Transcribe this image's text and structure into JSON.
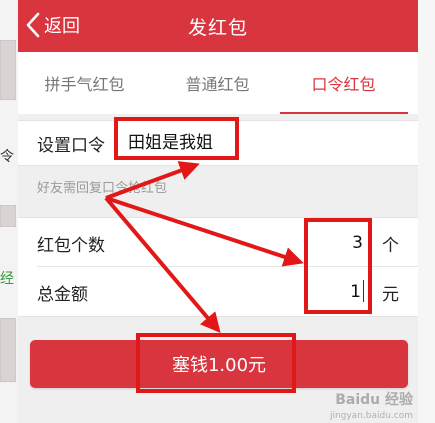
{
  "header": {
    "back_label": "返回",
    "title": "发红包"
  },
  "tabs": [
    {
      "label": "拼手气红包"
    },
    {
      "label": "普通红包"
    },
    {
      "label": "口令红包"
    }
  ],
  "command": {
    "label": "设置口令",
    "value": "田姐是我姐"
  },
  "hint": "好友需回复口令抢红包",
  "count": {
    "label": "红包个数",
    "value": "3",
    "unit": "个"
  },
  "amount": {
    "label": "总金额",
    "value": "1",
    "unit": "元"
  },
  "submit_label": "塞钱1.00元",
  "side": {
    "char_ling": "令",
    "char_jing": "经"
  },
  "watermark": {
    "brand": "Baidu 经验",
    "url": "jingyan.baidu.com"
  },
  "colors": {
    "accent": "#d8353f",
    "annotation": "#e21818"
  }
}
